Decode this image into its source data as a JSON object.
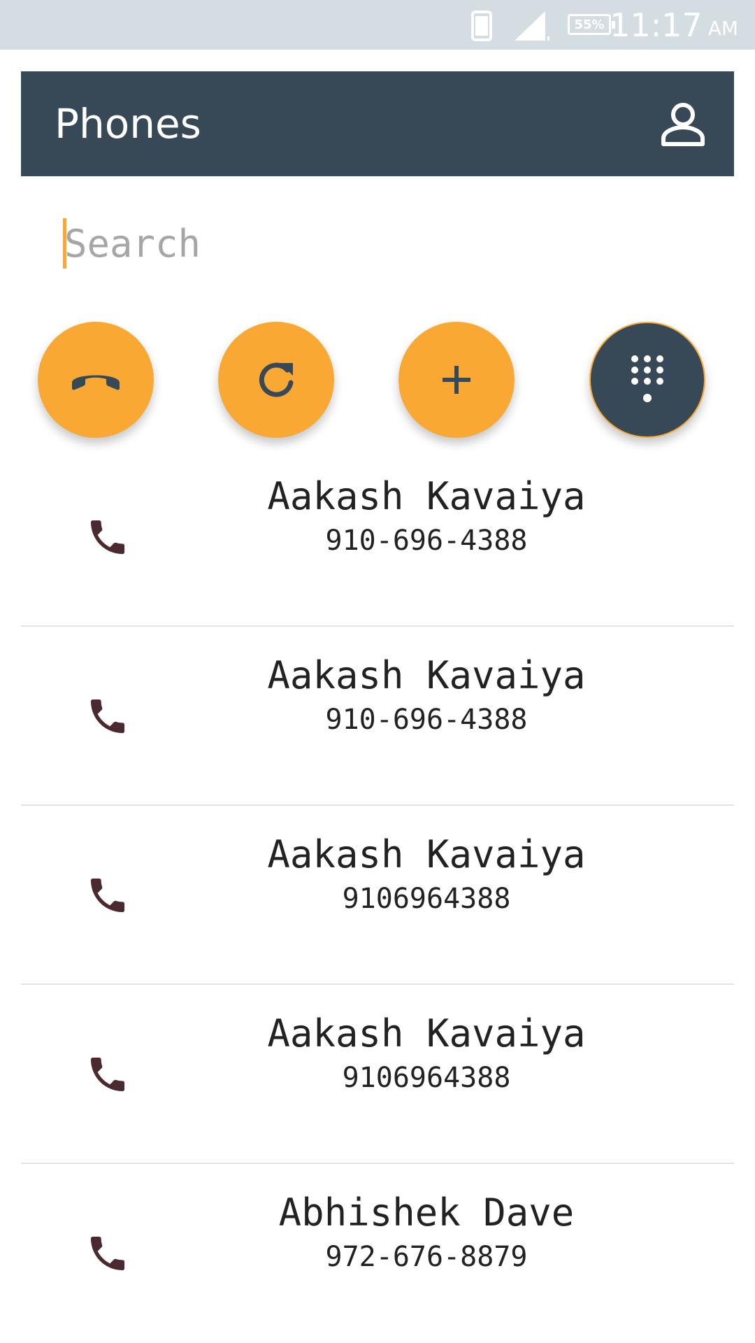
{
  "status_bar": {
    "battery": "55%",
    "time": "11:17",
    "ampm": "AM"
  },
  "app_bar": {
    "title": "Phones",
    "account_icon": "account-icon"
  },
  "search": {
    "placeholder": "Search",
    "value": ""
  },
  "actions": [
    {
      "icon": "end-call-icon"
    },
    {
      "icon": "refresh-icon"
    },
    {
      "icon": "add-icon"
    },
    {
      "icon": "dialpad-icon"
    }
  ],
  "contacts": [
    {
      "name": "Aakash Kavaiya",
      "number": "910-696-4388"
    },
    {
      "name": "Aakash Kavaiya",
      "number": "910-696-4388"
    },
    {
      "name": "Aakash Kavaiya",
      "number": "9106964388"
    },
    {
      "name": "Aakash Kavaiya",
      "number": "9106964388"
    },
    {
      "name": "Abhishek Dave",
      "number": "972-676-8879"
    }
  ],
  "colors": {
    "accent": "#f9a933",
    "primary": "#374957",
    "status_bar": "#d3dde2",
    "call_icon": "#4a2a2e"
  }
}
